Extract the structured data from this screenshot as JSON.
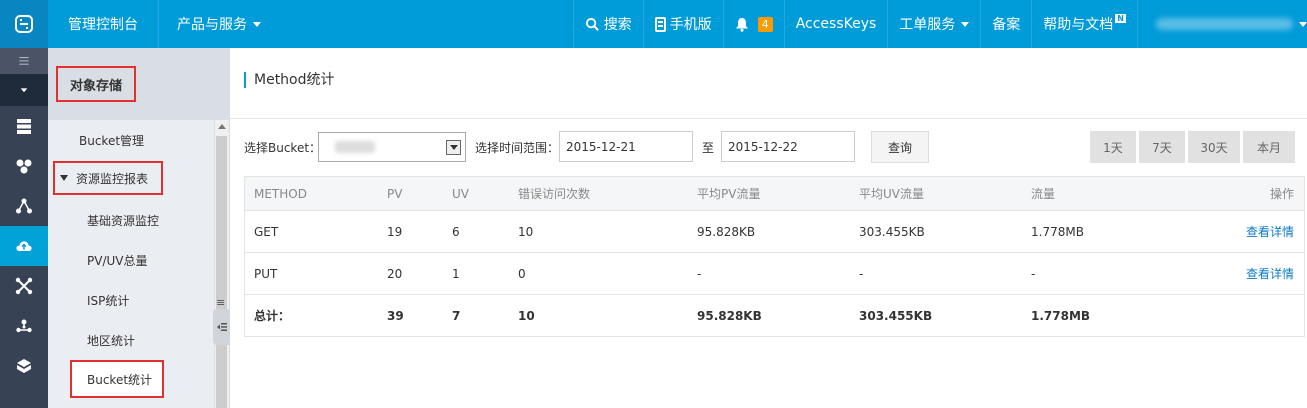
{
  "topbar": {
    "console": "管理控制台",
    "products": "产品与服务",
    "search": "搜索",
    "mobile": "手机版",
    "notify_count": "4",
    "accesskeys": "AccessKeys",
    "ticket": "工单服务",
    "record": "备案",
    "help": "帮助与文档",
    "help_badge": "N"
  },
  "iconbar": [
    "menu-icon",
    "collapse-icon",
    "server-icon",
    "cluster-icon",
    "network-icon",
    "cloud-storage-icon",
    "node-icon",
    "share-icon",
    "box-icon"
  ],
  "sidebar": {
    "header": "对象存储",
    "bucket_manage": "Bucket管理",
    "group": "资源监控报表",
    "items": [
      "基础资源监控",
      "PV/UV总量",
      "ISP统计",
      "地区统计",
      "Bucket统计"
    ]
  },
  "main": {
    "title": "Method统计",
    "select_bucket_label": "选择Bucket：",
    "time_range_label": "选择时间范围：",
    "start_date": "2015-12-21",
    "to": "至",
    "end_date": "2015-12-22",
    "query": "查询",
    "ranges": [
      "1天",
      "7天",
      "30天",
      "本月"
    ]
  },
  "table": {
    "headers": [
      "METHOD",
      "PV",
      "UV",
      "错误访问次数",
      "平均PV流量",
      "平均UV流量",
      "流量",
      "操作"
    ],
    "rows": [
      [
        "GET",
        "19",
        "6",
        "10",
        "95.828KB",
        "303.455KB",
        "1.778MB",
        "查看详情"
      ],
      [
        "PUT",
        "20",
        "1",
        "0",
        "-",
        "-",
        "-",
        "查看详情"
      ]
    ],
    "total": [
      "总计：",
      "39",
      "7",
      "10",
      "95.828KB",
      "303.455KB",
      "1.778MB"
    ]
  }
}
